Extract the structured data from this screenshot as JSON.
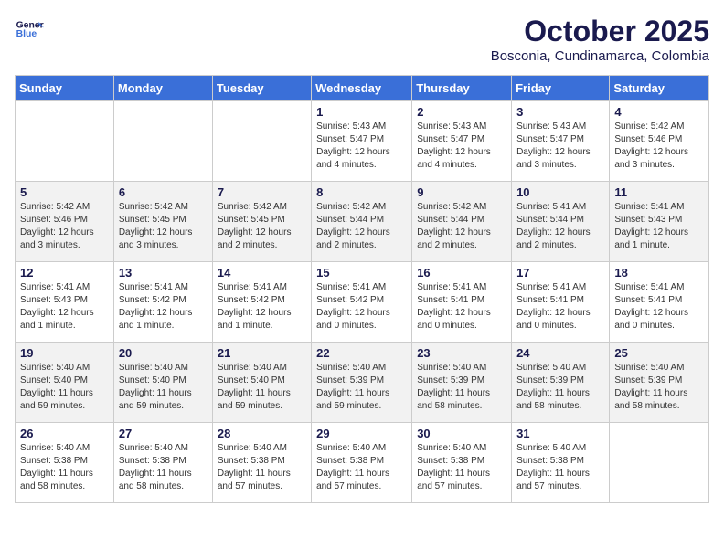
{
  "header": {
    "logo_line1": "General",
    "logo_line2": "Blue",
    "month_title": "October 2025",
    "location": "Bosconia, Cundinamarca, Colombia"
  },
  "days_of_week": [
    "Sunday",
    "Monday",
    "Tuesday",
    "Wednesday",
    "Thursday",
    "Friday",
    "Saturday"
  ],
  "weeks": [
    [
      {
        "day": "",
        "info": ""
      },
      {
        "day": "",
        "info": ""
      },
      {
        "day": "",
        "info": ""
      },
      {
        "day": "1",
        "info": "Sunrise: 5:43 AM\nSunset: 5:47 PM\nDaylight: 12 hours\nand 4 minutes."
      },
      {
        "day": "2",
        "info": "Sunrise: 5:43 AM\nSunset: 5:47 PM\nDaylight: 12 hours\nand 4 minutes."
      },
      {
        "day": "3",
        "info": "Sunrise: 5:43 AM\nSunset: 5:47 PM\nDaylight: 12 hours\nand 3 minutes."
      },
      {
        "day": "4",
        "info": "Sunrise: 5:42 AM\nSunset: 5:46 PM\nDaylight: 12 hours\nand 3 minutes."
      }
    ],
    [
      {
        "day": "5",
        "info": "Sunrise: 5:42 AM\nSunset: 5:46 PM\nDaylight: 12 hours\nand 3 minutes."
      },
      {
        "day": "6",
        "info": "Sunrise: 5:42 AM\nSunset: 5:45 PM\nDaylight: 12 hours\nand 3 minutes."
      },
      {
        "day": "7",
        "info": "Sunrise: 5:42 AM\nSunset: 5:45 PM\nDaylight: 12 hours\nand 2 minutes."
      },
      {
        "day": "8",
        "info": "Sunrise: 5:42 AM\nSunset: 5:44 PM\nDaylight: 12 hours\nand 2 minutes."
      },
      {
        "day": "9",
        "info": "Sunrise: 5:42 AM\nSunset: 5:44 PM\nDaylight: 12 hours\nand 2 minutes."
      },
      {
        "day": "10",
        "info": "Sunrise: 5:41 AM\nSunset: 5:44 PM\nDaylight: 12 hours\nand 2 minutes."
      },
      {
        "day": "11",
        "info": "Sunrise: 5:41 AM\nSunset: 5:43 PM\nDaylight: 12 hours\nand 1 minute."
      }
    ],
    [
      {
        "day": "12",
        "info": "Sunrise: 5:41 AM\nSunset: 5:43 PM\nDaylight: 12 hours\nand 1 minute."
      },
      {
        "day": "13",
        "info": "Sunrise: 5:41 AM\nSunset: 5:42 PM\nDaylight: 12 hours\nand 1 minute."
      },
      {
        "day": "14",
        "info": "Sunrise: 5:41 AM\nSunset: 5:42 PM\nDaylight: 12 hours\nand 1 minute."
      },
      {
        "day": "15",
        "info": "Sunrise: 5:41 AM\nSunset: 5:42 PM\nDaylight: 12 hours\nand 0 minutes."
      },
      {
        "day": "16",
        "info": "Sunrise: 5:41 AM\nSunset: 5:41 PM\nDaylight: 12 hours\nand 0 minutes."
      },
      {
        "day": "17",
        "info": "Sunrise: 5:41 AM\nSunset: 5:41 PM\nDaylight: 12 hours\nand 0 minutes."
      },
      {
        "day": "18",
        "info": "Sunrise: 5:41 AM\nSunset: 5:41 PM\nDaylight: 12 hours\nand 0 minutes."
      }
    ],
    [
      {
        "day": "19",
        "info": "Sunrise: 5:40 AM\nSunset: 5:40 PM\nDaylight: 11 hours\nand 59 minutes."
      },
      {
        "day": "20",
        "info": "Sunrise: 5:40 AM\nSunset: 5:40 PM\nDaylight: 11 hours\nand 59 minutes."
      },
      {
        "day": "21",
        "info": "Sunrise: 5:40 AM\nSunset: 5:40 PM\nDaylight: 11 hours\nand 59 minutes."
      },
      {
        "day": "22",
        "info": "Sunrise: 5:40 AM\nSunset: 5:39 PM\nDaylight: 11 hours\nand 59 minutes."
      },
      {
        "day": "23",
        "info": "Sunrise: 5:40 AM\nSunset: 5:39 PM\nDaylight: 11 hours\nand 58 minutes."
      },
      {
        "day": "24",
        "info": "Sunrise: 5:40 AM\nSunset: 5:39 PM\nDaylight: 11 hours\nand 58 minutes."
      },
      {
        "day": "25",
        "info": "Sunrise: 5:40 AM\nSunset: 5:39 PM\nDaylight: 11 hours\nand 58 minutes."
      }
    ],
    [
      {
        "day": "26",
        "info": "Sunrise: 5:40 AM\nSunset: 5:38 PM\nDaylight: 11 hours\nand 58 minutes."
      },
      {
        "day": "27",
        "info": "Sunrise: 5:40 AM\nSunset: 5:38 PM\nDaylight: 11 hours\nand 58 minutes."
      },
      {
        "day": "28",
        "info": "Sunrise: 5:40 AM\nSunset: 5:38 PM\nDaylight: 11 hours\nand 57 minutes."
      },
      {
        "day": "29",
        "info": "Sunrise: 5:40 AM\nSunset: 5:38 PM\nDaylight: 11 hours\nand 57 minutes."
      },
      {
        "day": "30",
        "info": "Sunrise: 5:40 AM\nSunset: 5:38 PM\nDaylight: 11 hours\nand 57 minutes."
      },
      {
        "day": "31",
        "info": "Sunrise: 5:40 AM\nSunset: 5:38 PM\nDaylight: 11 hours\nand 57 minutes."
      },
      {
        "day": "",
        "info": ""
      }
    ]
  ]
}
